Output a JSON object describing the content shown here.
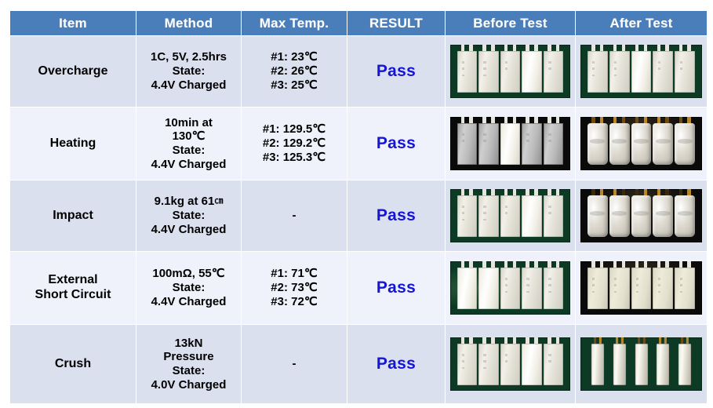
{
  "table": {
    "headers": [
      {
        "key": "item",
        "label": "Item"
      },
      {
        "key": "method",
        "label": "Method"
      },
      {
        "key": "temp",
        "label": "Max Temp."
      },
      {
        "key": "result",
        "label": "RESULT"
      },
      {
        "key": "before",
        "label": "Before Test"
      },
      {
        "key": "after",
        "label": "After Test"
      }
    ],
    "header_bg": "#4a7ebb",
    "header_text_color": "#ffffff",
    "row_shade_a": "#dbe0ef",
    "row_shade_b": "#eff2fa",
    "result_color": "#1515d8",
    "rows": [
      {
        "item": "Overcharge",
        "method_lines": [
          "1C, 5V, 2.5hrs",
          "State:",
          "4.4V Charged"
        ],
        "temp_lines": [
          "#1: 23℃",
          "#2: 26℃",
          "#3: 25℃"
        ],
        "result": "Pass",
        "before_photo": "five-flat-pouch-cells-on-green-board",
        "after_photo": "five-flat-pouch-cells-on-green-board"
      },
      {
        "item": "Heating",
        "method_lines": [
          "10min  at",
          "130℃",
          "State:",
          "4.4V Charged"
        ],
        "temp_lines": [
          "#1: 129.5℃",
          "#2: 129.2℃",
          "#3: 125.3℃"
        ],
        "result": "Pass",
        "before_photo": "five-gray-pouch-cells-on-black-background",
        "after_photo": "five-swollen-pouch-cells-with-browned-tabs-on-black-background"
      },
      {
        "item": "Impact",
        "method_lines": [
          "9.1kg at 61",
          "State:",
          "4.4V Charged"
        ],
        "method_unit": "㎝",
        "temp_lines": [
          "-"
        ],
        "result": "Pass",
        "before_photo": "five-flat-pouch-cells-on-green-board",
        "after_photo": "five-swollen-creased-pouch-cells-with-burnt-tabs"
      },
      {
        "item": "External\nShort Circuit",
        "item_lines": [
          "External",
          "Short Circuit"
        ],
        "method_lines": [
          "100mΩ, 55℃",
          "State:",
          "4.4V Charged"
        ],
        "temp_lines": [
          "#1: 71℃",
          "#2: 73℃",
          "#3: 72℃"
        ],
        "result": "Pass",
        "before_photo": "five-flat-pouch-cells-on-green-board-with-glare",
        "after_photo": "five-cream-pouch-cells-on-black-background"
      },
      {
        "item": "Crush",
        "method_lines": [
          "13kN",
          "Pressure",
          "State:",
          "4.0V Charged"
        ],
        "temp_lines": [
          "-"
        ],
        "result": "Pass",
        "before_photo": "five-flat-pouch-cells-on-green-board",
        "after_photo": "five-narrow-crushed-pouch-cells-with-gold-tabs-on-green-board"
      }
    ]
  }
}
